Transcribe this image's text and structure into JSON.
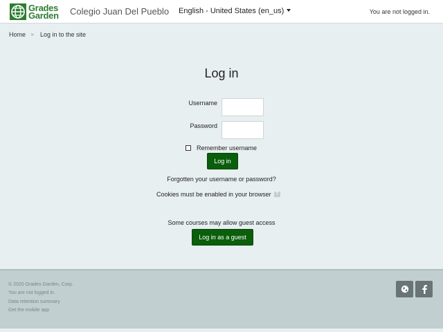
{
  "navbar": {
    "logo_line1": "Grades",
    "logo_line2": "Garden",
    "site_name": "Colegio Juan Del Pueblo",
    "language": "English - United States (en_us)",
    "login_status": "You are not logged in."
  },
  "breadcrumb": {
    "home": "Home",
    "current": "Log in to the site"
  },
  "login": {
    "title": "Log in",
    "username_label": "Username",
    "username_value": "",
    "password_label": "Password",
    "password_value": "",
    "remember_label": "Remember username",
    "login_button": "Log in",
    "forgot_link": "Forgotten your username or password?",
    "cookies_note": "Cookies must be enabled in your browser",
    "guest_note": "Some courses may allow guest access",
    "guest_button": "Log in as a guest"
  },
  "footer": {
    "copyright": "© 2020 Grades Garden, Corp.",
    "login_status": "You are not logged in.",
    "data_retention": "Data retention summary",
    "mobile_app": "Get the mobile app",
    "icons": [
      "globe-icon",
      "facebook-icon"
    ]
  },
  "colors": {
    "brand_green": "#0b5e0b",
    "page_bg": "#e8eff0",
    "footer_bg": "#c2cfd0"
  }
}
